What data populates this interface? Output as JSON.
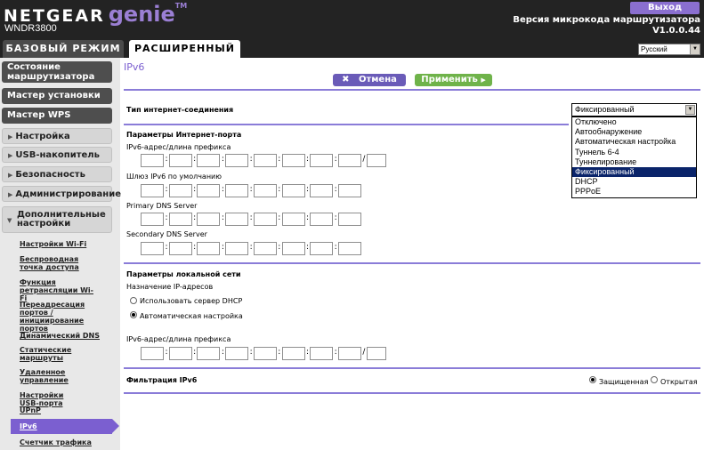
{
  "header": {
    "brand_netgear": "NETGEAR",
    "brand_genie": "genie",
    "brand_tm": "TM",
    "model": "WNDR3800",
    "logout_label": "Выход",
    "firmware_label": "Версия микрокода маршрутизатора",
    "firmware_version": "V1.0.0.44"
  },
  "tabs": {
    "basic": "БАЗОВЫЙ РЕЖИМ",
    "advanced": "РАСШИРЕННЫЙ"
  },
  "language": {
    "selected": "Русский"
  },
  "sidebar": {
    "router_status": "Состояние маршрутизатора",
    "setup_wizard": "Мастер установки",
    "wps_wizard": "Мастер WPS",
    "setup": "Настройка",
    "usb_storage": "USB-накопитель",
    "security": "Безопасность",
    "administration": "Администрирование",
    "advanced_setup": "Дополнительные настройки",
    "subs": [
      "Настройки Wi-Fi",
      "Беспроводная точка доступа",
      "Функция ретрансляции Wi-Fi",
      "Переадресация портов / инициирование портов",
      "Динамический DNS",
      "Статические маршруты",
      "Удаленное управление",
      "Настройки USB-порта",
      "UPnP",
      "IPv6",
      "Счетчик трафика"
    ]
  },
  "main": {
    "title": "IPv6",
    "cancel_label": "Отмена",
    "apply_label": "Применить",
    "conn_type_label": "Тип интернет-соединения",
    "conn_type_selected": "Фиксированный",
    "conn_type_options": [
      "Отключено",
      "Автообнаружение",
      "Автоматическая настройка",
      "Туннель 6-4",
      "Туннелирование",
      "Фиксированный",
      "DHCP",
      "PPPoE"
    ],
    "conn_type_selected_index": 5,
    "internet_port_header": "Параметры Интернет-порта",
    "ipv6_prefix_label": "IPv6-адрес/длина префикса",
    "gateway_label": "Шлюз IPv6 по умолчанию",
    "primary_dns_label": "Primary DNS Server",
    "secondary_dns_label": "Secondary DNS Server",
    "lan_header": "Параметры локальной сети",
    "ip_assign_label": "Назначение IP-адресов",
    "use_dhcp_label": "Использовать сервер DHCP",
    "auto_config_label": "Автоматическая настройка",
    "lan_prefix_label": "IPv6-адрес/длина префикса",
    "filter_label": "Фильтрация IPv6",
    "secured_label": "Защищенная",
    "open_label": "Открытая",
    "ip_sep": ":",
    "prefix_sep": "/"
  }
}
